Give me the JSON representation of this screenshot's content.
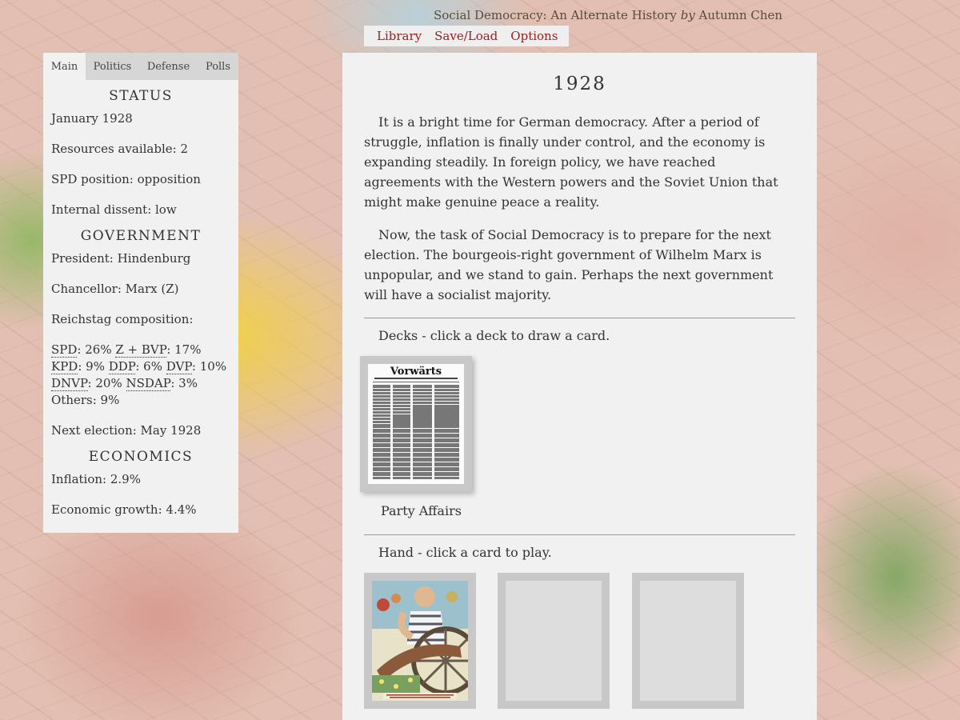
{
  "credit": {
    "game_title": "Social Democracy: An Alternate History",
    "by": "by",
    "author": "Autumn Chen"
  },
  "menu": {
    "library": "Library",
    "save_load": "Save/Load",
    "options": "Options"
  },
  "sidebar": {
    "tabs": [
      "Main",
      "Politics",
      "Defense",
      "Polls"
    ],
    "status_heading": "STATUS",
    "date": "January 1928",
    "resources": "Resources available: 2",
    "spd_position": "SPD position: opposition",
    "internal_dissent": "Internal dissent: low",
    "government_heading": "GOVERNMENT",
    "president": "President: Hindenburg",
    "chancellor": "Chancellor: Marx (Z)",
    "reichstag_label": "Reichstag composition:",
    "reichstag": [
      {
        "party": "SPD",
        "value": ": 26%"
      },
      {
        "party": "Z + BVP",
        "value": ": 17%"
      },
      {
        "party": "KPD",
        "value": ": 9%"
      },
      {
        "party": "DDP",
        "value": ": 6%"
      },
      {
        "party": "DVP",
        "value": ": 10%"
      },
      {
        "party": "DNVP",
        "value": ": 20%"
      },
      {
        "party": "NSDAP",
        "value": ": 3%"
      },
      {
        "party": "Others",
        "value": ": 9%"
      }
    ],
    "next_election": "Next election: May 1928",
    "economics_heading": "ECONOMICS",
    "inflation": "Inflation: 2.9%",
    "growth": "Economic growth: 4.4%"
  },
  "main": {
    "year_title": "1928",
    "paragraph1": "It is a bright time for German democracy. After a period of struggle, inflation is finally under control, and the economy is expanding steadily. In foreign policy, we have reached agreements with the Western powers and the Soviet Union that might make genuine peace a reality.",
    "paragraph2": "Now, the task of Social Democracy is to prepare for the next election. The bourgeois-right government of Wilhelm Marx is unpopular, and we stand to gain. Perhaps the next government will have a socialist majority.",
    "decks_instruction": "Decks - click a deck to draw a card.",
    "deck": {
      "masthead": "Vorwärts",
      "label": "Party Affairs"
    },
    "hand_instruction": "Hand - click a card to play."
  }
}
